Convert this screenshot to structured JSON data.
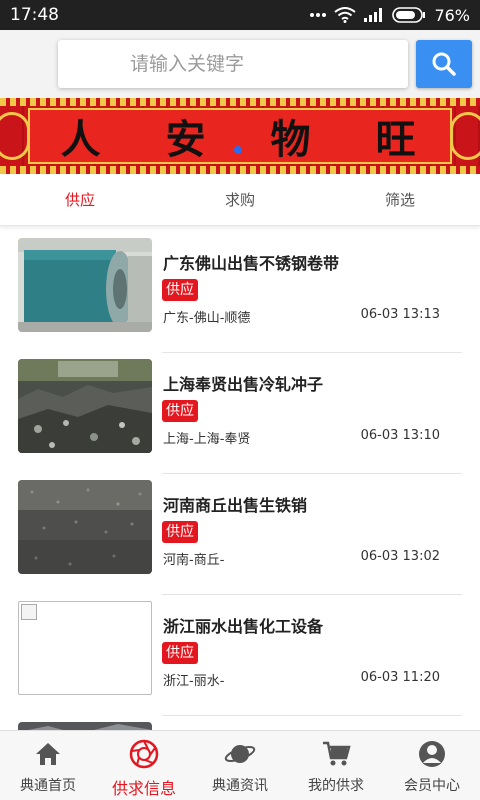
{
  "status_bar": {
    "time": "17:48",
    "battery": "76%"
  },
  "search": {
    "placeholder": "请输入关键字"
  },
  "banner": {
    "slogan": [
      "人",
      "安",
      "物",
      "旺"
    ]
  },
  "tabs": [
    {
      "label": "供应",
      "active": true
    },
    {
      "label": "求购",
      "active": false
    },
    {
      "label": "筛选",
      "active": false
    }
  ],
  "listings": [
    {
      "title": "广东佛山出售不锈钢卷带",
      "badge": "供应",
      "location": "广东-佛山-顺德",
      "time": "06-03 13:13",
      "thumb": "steel-coil"
    },
    {
      "title": "上海奉贤出售冷轧冲子",
      "badge": "供应",
      "location": "上海-上海-奉贤",
      "time": "06-03 13:10",
      "thumb": "scrap-pile"
    },
    {
      "title": "河南商丘出售生铁销",
      "badge": "供应",
      "location": "河南-商丘-",
      "time": "06-03 13:02",
      "thumb": "iron-ground"
    },
    {
      "title": "浙江丽水出售化工设备",
      "badge": "供应",
      "location": "浙江-丽水-",
      "time": "06-03 11:20",
      "thumb": "broken-image"
    }
  ],
  "bottom_nav": [
    {
      "label": "典通首页",
      "icon": "home-icon",
      "active": false
    },
    {
      "label": "供求信息",
      "icon": "aperture-icon",
      "active": true
    },
    {
      "label": "典通资讯",
      "icon": "planet-icon",
      "active": false
    },
    {
      "label": "我的供求",
      "icon": "cart-icon",
      "active": false
    },
    {
      "label": "会员中心",
      "icon": "user-icon",
      "active": false
    }
  ],
  "colors": {
    "accent": "#e3171f",
    "search_button": "#3a8ff2",
    "status_bar": "#212121"
  }
}
